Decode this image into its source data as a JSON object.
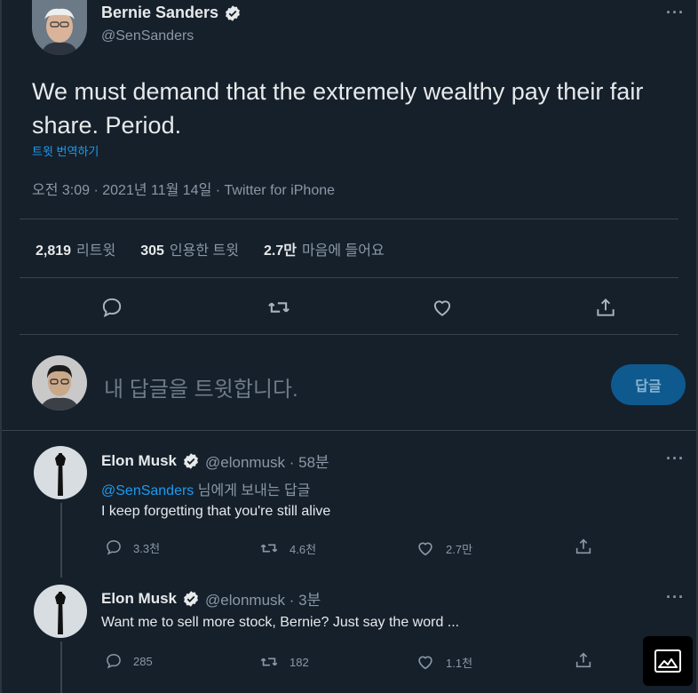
{
  "main_tweet": {
    "author_name": "Bernie Sanders",
    "handle": "@SenSanders",
    "text": "We must demand that the extremely wealthy pay their fair share. Period.",
    "translate_label": "트윗 번역하기",
    "meta": "오전 3:09 · 2021년 11월 14일 · Twitter for iPhone",
    "stats": [
      {
        "count": "2,819",
        "label": "리트윗"
      },
      {
        "count": "305",
        "label": "인용한 트윗"
      },
      {
        "count": "2.7만",
        "label": "마음에 들어요"
      }
    ]
  },
  "compose": {
    "placeholder": "내 답글을 트윗합니다.",
    "reply_button": "답글"
  },
  "replies": [
    {
      "author_name": "Elon Musk",
      "handle_time": "@elonmusk · 58분",
      "reply_to_mention": "@SenSanders",
      "reply_to_suffix": " 님에게 보내는 답글",
      "text": "I keep forgetting that you're still alive",
      "reply_count": "3.3천",
      "retweet_count": "4.6천",
      "like_count": "2.7만"
    },
    {
      "author_name": "Elon Musk",
      "handle_time": "@elonmusk · 3분",
      "text": "Want me to sell more stock, Bernie? Just say the word ...",
      "reply_count": "285",
      "retweet_count": "182",
      "like_count": "1.1천"
    }
  ],
  "colors": {
    "background": "#15202b",
    "accent": "#1d9bf0",
    "muted": "#8b98a5",
    "text": "#e7e9ea"
  },
  "icons": [
    "verified-badge-icon",
    "more-icon",
    "reply-icon",
    "retweet-icon",
    "like-icon",
    "share-icon",
    "image-icon"
  ]
}
